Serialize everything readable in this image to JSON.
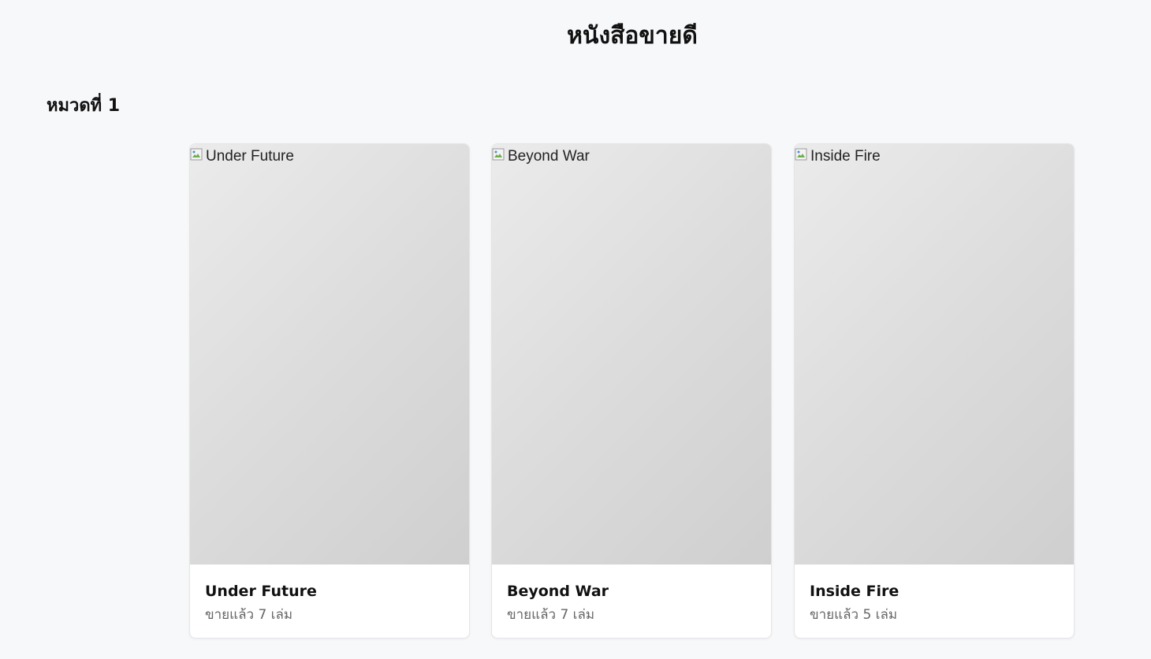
{
  "page": {
    "title": "หนังสือขายดี"
  },
  "section": {
    "heading": "หมวดที่ 1"
  },
  "books": [
    {
      "cover_alt": "Under Future",
      "title": "Under Future",
      "sold_text": "ขายแล้ว 7 เล่ม"
    },
    {
      "cover_alt": "Beyond War",
      "title": "Beyond War",
      "sold_text": "ขายแล้ว 7 เล่ม"
    },
    {
      "cover_alt": "Inside Fire",
      "title": "Inside Fire",
      "sold_text": "ขายแล้ว 5 เล่ม"
    }
  ],
  "icons": {
    "broken_image": "broken-image-icon"
  },
  "colors": {
    "background": "#f7f8fa",
    "card": "#ffffff",
    "muted_text": "#666666"
  }
}
